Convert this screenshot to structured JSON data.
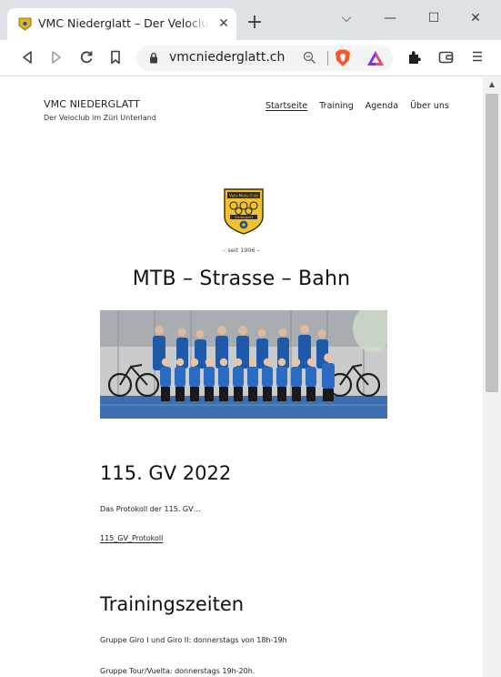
{
  "browser": {
    "tab_title": "VMC Niederglatt – Der Veloclub im Züri Unterland",
    "tab_close": "✕",
    "new_tab": "+",
    "window": {
      "menu": "⌵",
      "minimize": "—",
      "maximize": "☐",
      "close": "✕"
    },
    "url": "vmcniederglatt.ch",
    "icons": [
      "back-icon",
      "forward-icon",
      "reload-icon",
      "bookmark-icon",
      "lock-icon",
      "zoom-icon",
      "brave-shield-icon",
      "brave-rewards-icon",
      "extensions-icon",
      "wallet-icon",
      "menu-icon"
    ]
  },
  "site": {
    "name": "VMC NIEDERGLATT",
    "tagline": "Der Veloclub im Züri Unterland",
    "nav": [
      {
        "label": "Startseite",
        "active": true
      },
      {
        "label": "Training",
        "active": false
      },
      {
        "label": "Agenda",
        "active": false
      },
      {
        "label": "Über uns",
        "active": false
      }
    ],
    "logo": {
      "top_text": "Velo-Moto-Club",
      "bottom_text": "Niederglatt"
    },
    "since": "– seit 1906 –",
    "hero_title": "MTB – Strasse – Bahn"
  },
  "sections": {
    "gv": {
      "heading": "115. GV 2022",
      "text": "Das Protokoll der 115. GV…",
      "link": "115_GV_Protokoll"
    },
    "training": {
      "heading": "Trainingszeiten",
      "lines": [
        "Gruppe Giro I und Giro II: donnerstags von 18h-19h",
        "Gruppe Tour/Vuelta: donnerstags 19h-20h."
      ]
    }
  },
  "colors": {
    "tabstrip": "#dee1e6",
    "omnibox": "#f1f3f4",
    "logo_yellow": "#f2c12e",
    "jersey_blue": "#1f5aa8",
    "gym_floor": "#3d6fb0"
  }
}
